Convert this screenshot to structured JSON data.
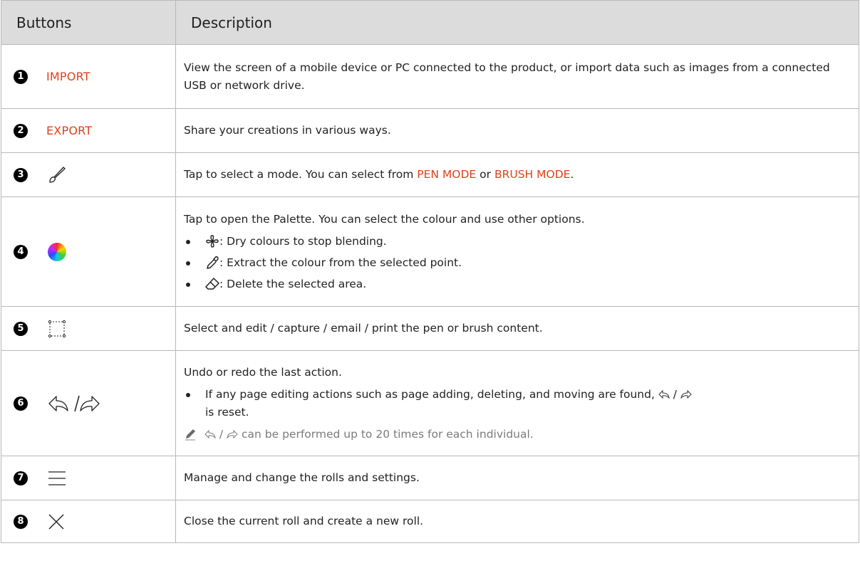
{
  "table": {
    "headers": {
      "buttons": "Buttons",
      "description": "Description"
    },
    "rows": [
      {
        "num": "1",
        "label": "IMPORT",
        "desc": "View the screen of a mobile device or PC connected to the product, or import data such as images from a connected USB or network drive."
      },
      {
        "num": "2",
        "label": "EXPORT",
        "desc": "Share your creations in various ways."
      },
      {
        "num": "3",
        "icon": "brush-icon",
        "desc_before": "Tap to select a mode. You can select from ",
        "desc_hl1": "PEN MODE",
        "desc_mid": " or ",
        "desc_hl2": "BRUSH MODE",
        "desc_after": "."
      },
      {
        "num": "4",
        "icon": "color-wheel-icon",
        "desc": "Tap to open the Palette. You can select the colour and use other options.",
        "bullets": [
          {
            "icon": "fan-icon",
            "text": ": Dry colours to stop blending."
          },
          {
            "icon": "eyedropper-icon",
            "text": ": Extract the colour from the selected point."
          },
          {
            "icon": "eraser-icon",
            "text": ": Delete the selected area."
          }
        ]
      },
      {
        "num": "5",
        "icon": "selection-icon",
        "desc": "Select and edit / capture / email / print the pen or brush content."
      },
      {
        "num": "6",
        "icon": "undo-redo-icon",
        "icon_sep": "/",
        "desc": "Undo or redo the last action.",
        "bullet_before": "If any page editing actions such as page adding, deleting, and moving are found, ",
        "bullet_sep": " / ",
        "bullet_after": " is reset.",
        "note_sep": " / ",
        "note_after": " can be performed up to 20 times for each individual."
      },
      {
        "num": "7",
        "icon": "menu-icon",
        "desc": "Manage and change the rolls and settings."
      },
      {
        "num": "8",
        "icon": "close-icon",
        "desc": "Close the current roll and create a new roll."
      }
    ]
  },
  "colors": {
    "accent": "#e1411b",
    "header_bg": "#dcdcdc",
    "border": "#b8b8b8",
    "note": "#7b7b7b"
  }
}
